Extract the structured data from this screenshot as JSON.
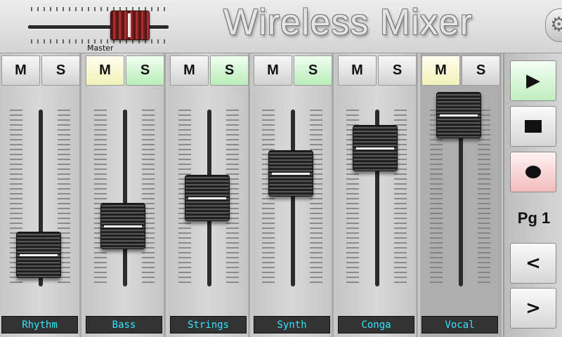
{
  "app": {
    "title": "Wireless Mixer"
  },
  "master": {
    "label": "Master",
    "level": 0.72
  },
  "icons": {
    "settings": "gear-icon",
    "play": "play-icon",
    "stop": "stop-icon",
    "record": "record-icon",
    "prev": "chevron-left-icon",
    "next": "chevron-right-icon"
  },
  "channels": [
    {
      "name": "Rhythm",
      "mute_label": "M",
      "solo_label": "S",
      "mute_on": false,
      "solo_on": false,
      "level": 0.18,
      "active": false
    },
    {
      "name": "Bass",
      "mute_label": "M",
      "solo_label": "S",
      "mute_on": true,
      "solo_on": true,
      "level": 0.34,
      "active": false
    },
    {
      "name": "Strings",
      "mute_label": "M",
      "solo_label": "S",
      "mute_on": false,
      "solo_on": true,
      "level": 0.5,
      "active": false
    },
    {
      "name": "Synth",
      "mute_label": "M",
      "solo_label": "S",
      "mute_on": false,
      "solo_on": true,
      "level": 0.64,
      "active": false
    },
    {
      "name": "Conga",
      "mute_label": "M",
      "solo_label": "S",
      "mute_on": false,
      "solo_on": false,
      "level": 0.78,
      "active": false
    },
    {
      "name": "Vocal",
      "mute_label": "M",
      "solo_label": "S",
      "mute_on": true,
      "solo_on": false,
      "level": 0.97,
      "active": true
    }
  ],
  "transport": {
    "page_label": "Pg 1",
    "prev_label": "<",
    "next_label": ">"
  },
  "colors": {
    "label_text": "#33e6ff",
    "mute_on": "#f2f2b8",
    "solo_on": "#b8edb8",
    "record": "#f2bcbc",
    "play": "#bfeebf",
    "master_knob": "#a33131"
  }
}
